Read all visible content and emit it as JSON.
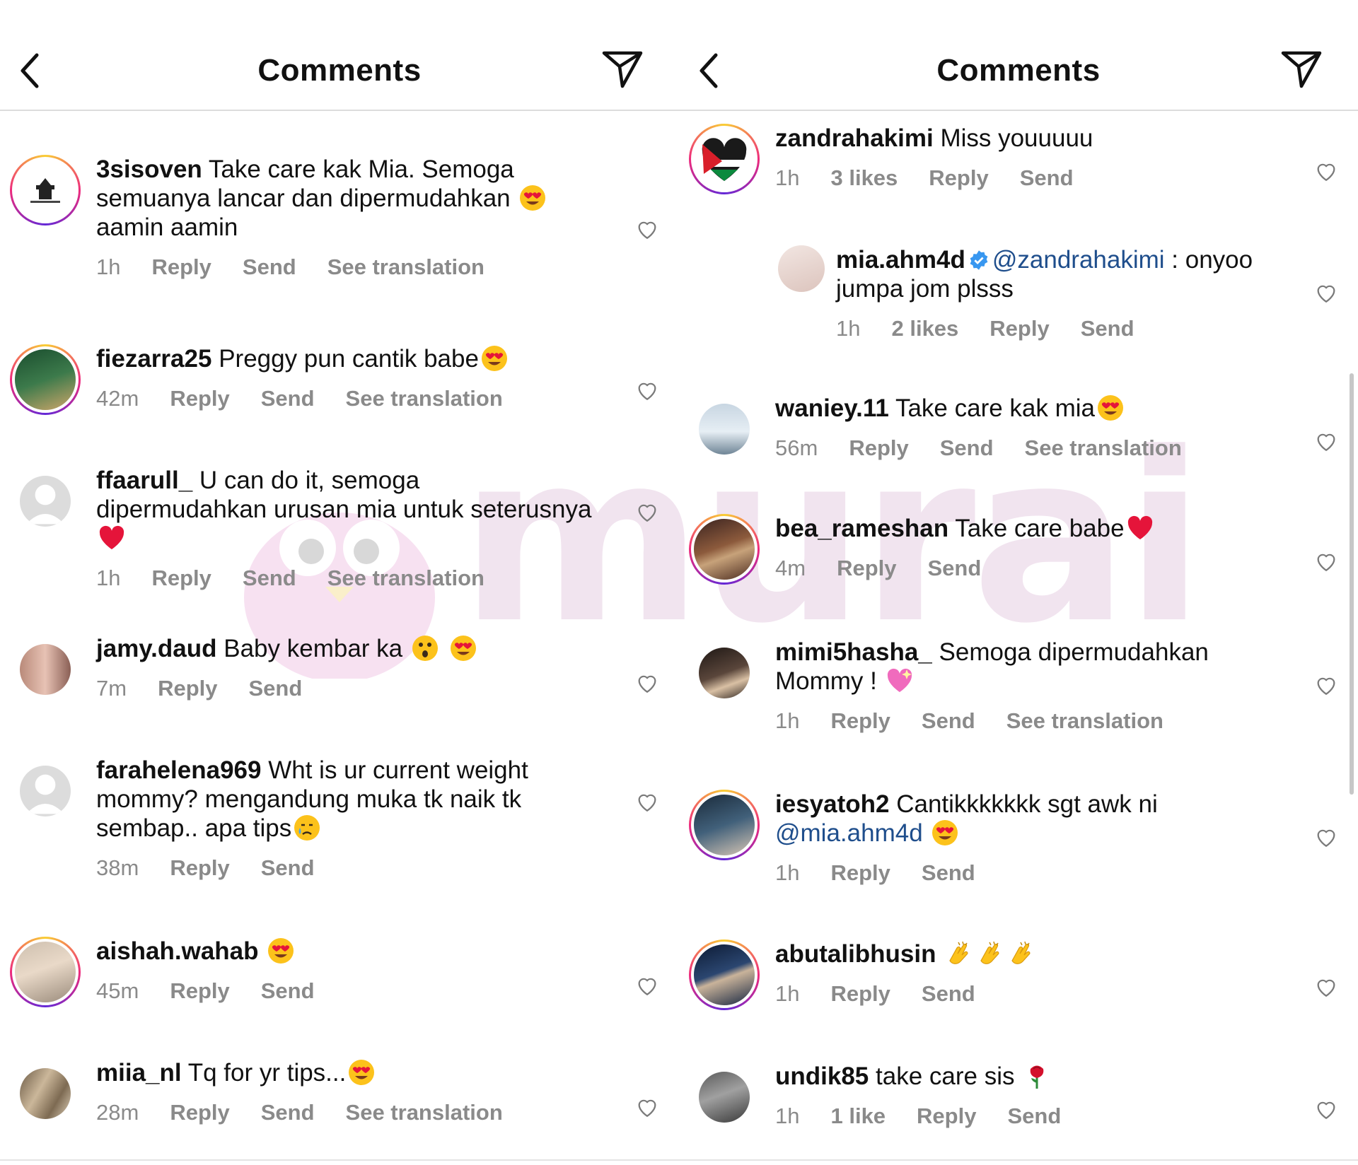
{
  "left": {
    "title": "Comments",
    "comments": [
      {
        "user": "3sisoven",
        "text": "Take care kak Mia. Semoga semuanya lancar dan dipermudahkan",
        "text2": "aamin aamin",
        "time": "1h",
        "reply": "Reply",
        "send": "Send",
        "translation": "See translation"
      },
      {
        "user": "fiezarra25",
        "text": "Preggy pun cantik babe",
        "time": "42m",
        "reply": "Reply",
        "send": "Send",
        "translation": "See translation"
      },
      {
        "user": "ffaarull_",
        "text": "U can do it, semoga dipermudahkan urusan mia untuk seterusnya",
        "time": "1h",
        "reply": "Reply",
        "send": "Send",
        "translation": "See translation"
      },
      {
        "user": "jamy.daud",
        "text": "Baby kembar ka",
        "time": "7m",
        "reply": "Reply",
        "send": "Send"
      },
      {
        "user": "farahelena969",
        "text": "Wht is ur current weight mommy? mengandung muka tk naik tk sembap.. apa tips",
        "time": "38m",
        "reply": "Reply",
        "send": "Send"
      },
      {
        "user": "aishah.wahab",
        "text": "",
        "time": "45m",
        "reply": "Reply",
        "send": "Send"
      },
      {
        "user": "miia_nl",
        "text": "Tq for yr tips...",
        "time": "28m",
        "reply": "Reply",
        "send": "Send",
        "translation": "See translation"
      }
    ]
  },
  "right": {
    "title": "Comments",
    "comments": [
      {
        "user": "zandrahakimi",
        "text": "Miss youuuuu",
        "time": "1h",
        "likes": "3 likes",
        "reply": "Reply",
        "send": "Send"
      },
      {
        "user": "mia.ahm4d",
        "mention": "@zandrahakimi",
        "text": ": onyoo jumpa jom plsss",
        "time": "1h",
        "likes": "2 likes",
        "reply": "Reply",
        "send": "Send"
      },
      {
        "user": "waniey.11",
        "text": "Take care kak mia",
        "time": "56m",
        "reply": "Reply",
        "send": "Send",
        "translation": "See translation"
      },
      {
        "user": "bea_rameshan",
        "text": "Take care babe",
        "time": "4m",
        "reply": "Reply",
        "send": "Send"
      },
      {
        "user": "mimi5hasha_",
        "text": "Semoga dipermudahkan Mommy !",
        "time": "1h",
        "reply": "Reply",
        "send": "Send",
        "translation": "See translation"
      },
      {
        "user": "iesyatoh2",
        "text": "Cantikkkkkkk sgt awk ni",
        "mention": "@mia.ahm4d",
        "time": "1h",
        "reply": "Reply",
        "send": "Send"
      },
      {
        "user": "abutalibhusin",
        "text": "",
        "time": "1h",
        "reply": "Reply",
        "send": "Send"
      },
      {
        "user": "undik85",
        "text": "take care sis",
        "time": "1h",
        "likes": "1 like",
        "reply": "Reply",
        "send": "Send"
      }
    ]
  },
  "icons": {
    "back": "chevron-left-icon",
    "share": "paper-plane-icon",
    "like": "heart-outline-icon",
    "verified": "verified-badge-icon"
  },
  "colors": {
    "story_ring": "#ee2a7b",
    "mention": "#1f4e8c",
    "meta": "#8a8a8a"
  },
  "watermark": {
    "text": "murai"
  }
}
